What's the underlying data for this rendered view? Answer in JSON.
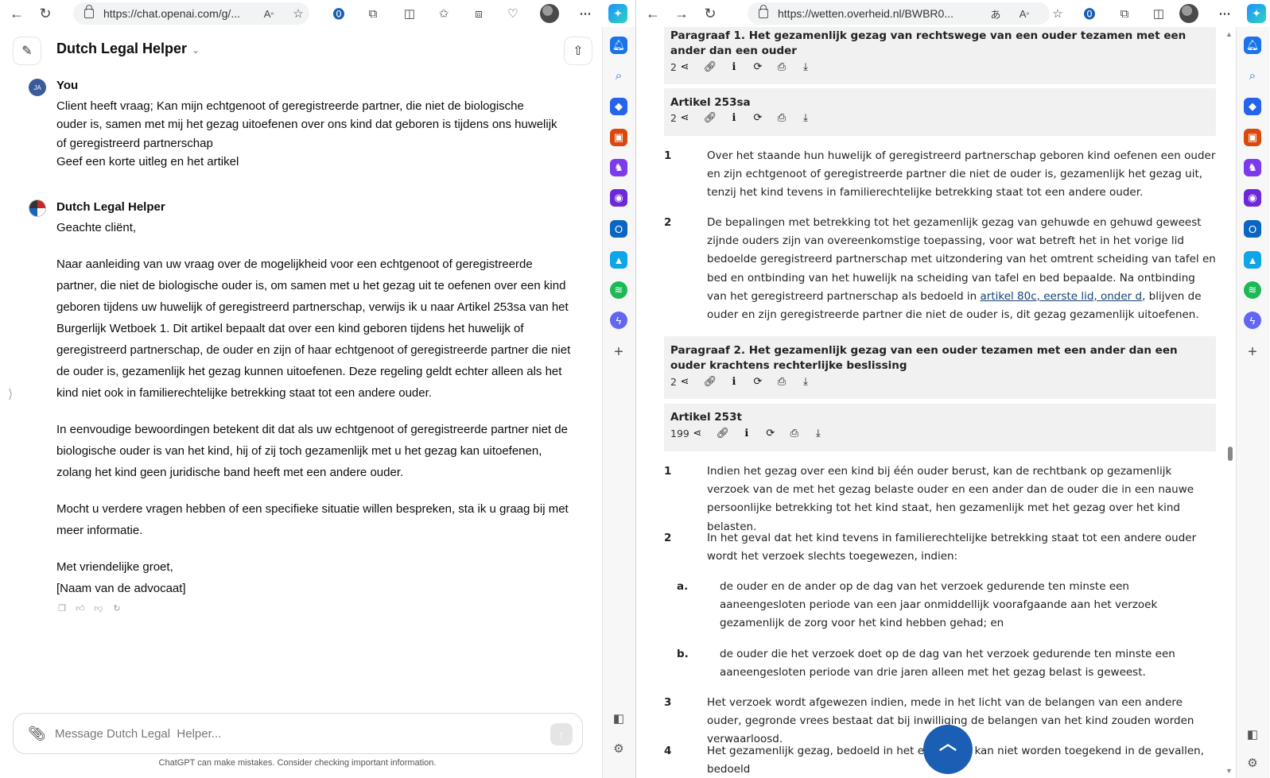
{
  "left_browser": {
    "url": "https://chat.openai.com/g/..."
  },
  "right_browser": {
    "url": "https://wetten.overheid.nl/BWBR0..."
  },
  "chatgpt": {
    "gpt_name": "Dutch Legal Helper",
    "user_initials": "JA",
    "user_label": "You",
    "user_message": [
      "Client heeft vraag; Kan mijn echtgenoot of geregistreerde partner, die niet de biologische ouder is, samen met mij het gezag uitoefenen over ons kind dat geboren is tijdens ons huwelijk of geregistreerd partnerschap",
      "Geef een korte uitleg en het artikel"
    ],
    "bot_label": "Dutch Legal Helper",
    "bot_message": [
      "Geachte cliënt,",
      "Naar aanleiding van uw vraag over de mogelijkheid voor een echtgenoot of geregistreerde partner, die niet de biologische ouder is, om samen met u het gezag uit te oefenen over een kind geboren tijdens uw huwelijk of geregistreerd partnerschap, verwijs ik u naar Artikel 253sa van het Burgerlijk Wetboek 1. Dit artikel bepaalt dat over een kind geboren tijdens het huwelijk of geregistreerd partnerschap, de ouder en zijn of haar echtgenoot of geregistreerde partner die niet de ouder is, gezamenlijk het gezag kunnen uitoefenen. Deze regeling geldt echter alleen als het kind niet ook in familierechtelijke betrekking staat tot een andere ouder.",
      "In eenvoudige bewoordingen betekent dit dat als uw echtgenoot of geregistreerde partner niet de biologische ouder is van het kind, hij of zij toch gezamenlijk met u het gezag kan uitoefenen, zolang het kind geen juridische band heeft met een andere ouder.",
      "Mocht u verdere vragen hebben of een specifieke situatie willen bespreken, sta ik u graag bij met meer informatie.",
      "Met vriendelijke groet,",
      "[Naam van de advocaat]"
    ],
    "input_placeholder": "Message Dutch Legal  Helper...",
    "disclaimer": "ChatGPT can make mistakes. Consider checking important information."
  },
  "wetten": {
    "par1_title": "Paragraaf 1. Het gezamenlijk gezag van rechtswege van een ouder tezamen met een ander dan een ouder",
    "par1_count": "2",
    "art253sa_title": "Artikel 253sa",
    "art253sa_count": "2",
    "art253sa_leden": [
      {
        "num": "1",
        "text": "Over het staande hun huwelijk of geregistreerd partnerschap geboren kind oefenen een ouder en zijn echtgenoot of geregistreerde partner die niet de ouder is, gezamenlijk het gezag uit, tenzij het kind tevens in familierechtelijke betrekking staat tot een andere ouder."
      },
      {
        "num": "2",
        "text_before": "De bepalingen met betrekking tot het gezamenlijk gezag van gehuwde en gehuwd geweest zijnde ouders zijn van overeenkomstige toepassing, voor wat betreft het in het vorige lid bedoelde geregistreerd partnerschap met uitzondering van het omtrent scheiding van tafel en bed en ontbinding van het huwelijk na scheiding van tafel en bed bepaalde. Na ontbinding van het geregistreerd partnerschap als bedoeld in ",
        "link": "artikel 80c, eerste lid, onder d",
        "text_after": ", blijven de ouder en zijn geregistreerde partner die niet de ouder is, dit gezag gezamenlijk uitoefenen."
      }
    ],
    "par2_title": "Paragraaf 2. Het gezamenlijk gezag van een ouder tezamen met een ander dan een ouder krachtens rechterlijke beslissing",
    "par2_count": "2",
    "art253t_title": "Artikel 253t",
    "art253t_count": "199",
    "art253t_leden": [
      {
        "num": "1",
        "text": "Indien het gezag over een kind bij één ouder berust, kan de rechtbank op gezamenlijk verzoek van de met het gezag belaste ouder en een ander dan de ouder die in een nauwe persoonlijke betrekking tot het kind staat, hen gezamenlijk met het gezag over het kind belasten."
      },
      {
        "num": "2",
        "text": "In het geval dat het kind tevens in familierechtelijke betrekking staat tot een andere ouder wordt het verzoek slechts toegewezen, indien:"
      },
      {
        "num": "a.",
        "text": "de ouder en de ander op de dag van het verzoek gedurende ten minste een aaneengesloten periode van een jaar onmiddellijk voorafgaande aan het verzoek gezamenlijk de zorg voor het kind hebben gehad; en"
      },
      {
        "num": "b.",
        "text": "de ouder die het verzoek doet op de dag van het verzoek gedurende ten minste een aaneengesloten periode van drie jaren alleen met het gezag belast is geweest."
      },
      {
        "num": "3",
        "text": "Het verzoek wordt afgewezen indien, mede in het licht van de belangen van een andere ouder, gegronde vrees bestaat dat bij inwilliging de belangen van het kind zouden worden verwaarloosd."
      },
      {
        "num": "4",
        "text": "Het gezamenlijk gezag, bedoeld in het eerste lid, kan niet worden toegekend in de gevallen, bedoeld"
      }
    ]
  }
}
